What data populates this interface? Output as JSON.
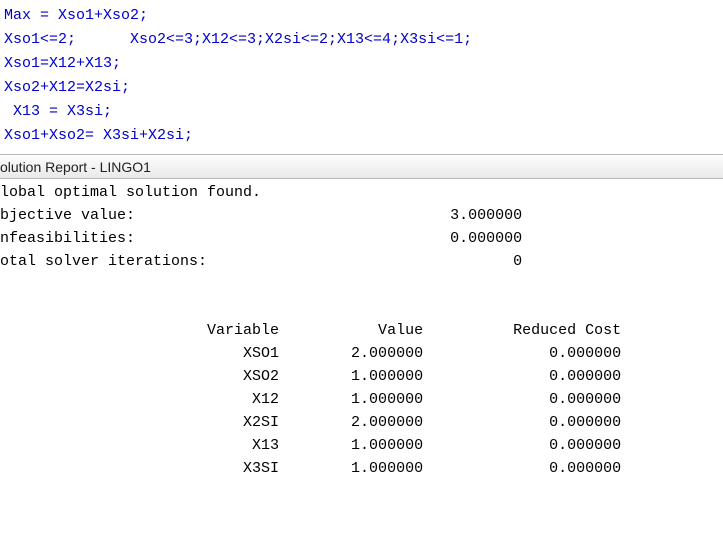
{
  "code": {
    "lines": [
      "Max = Xso1+Xso2;",
      "Xso1<=2;      Xso2<=3;X12<=3;X2si<=2;X13<=4;X3si<=1;",
      "Xso1=X12+X13;",
      "Xso2+X12=X2si;",
      " X13 = X3si;",
      "Xso1+Xso2= X3si+X2si;"
    ]
  },
  "report": {
    "title": "olution Report - LINGO1",
    "status_line": "lobal optimal solution found.",
    "objective_label": "bjective value:",
    "objective_value": "3.000000",
    "infeas_label": "nfeasibilities:",
    "infeas_value": "0.000000",
    "iter_label": "otal solver iterations:",
    "iter_value": "0",
    "columns": {
      "variable": "Variable",
      "value": "Value",
      "reduced_cost": "Reduced Cost"
    },
    "rows": [
      {
        "variable": "XSO1",
        "value": "2.000000",
        "reduced_cost": "0.000000"
      },
      {
        "variable": "XSO2",
        "value": "1.000000",
        "reduced_cost": "0.000000"
      },
      {
        "variable": "X12",
        "value": "1.000000",
        "reduced_cost": "0.000000"
      },
      {
        "variable": "X2SI",
        "value": "2.000000",
        "reduced_cost": "0.000000"
      },
      {
        "variable": "X13",
        "value": "1.000000",
        "reduced_cost": "0.000000"
      },
      {
        "variable": "X3SI",
        "value": "1.000000",
        "reduced_cost": "0.000000"
      }
    ]
  }
}
